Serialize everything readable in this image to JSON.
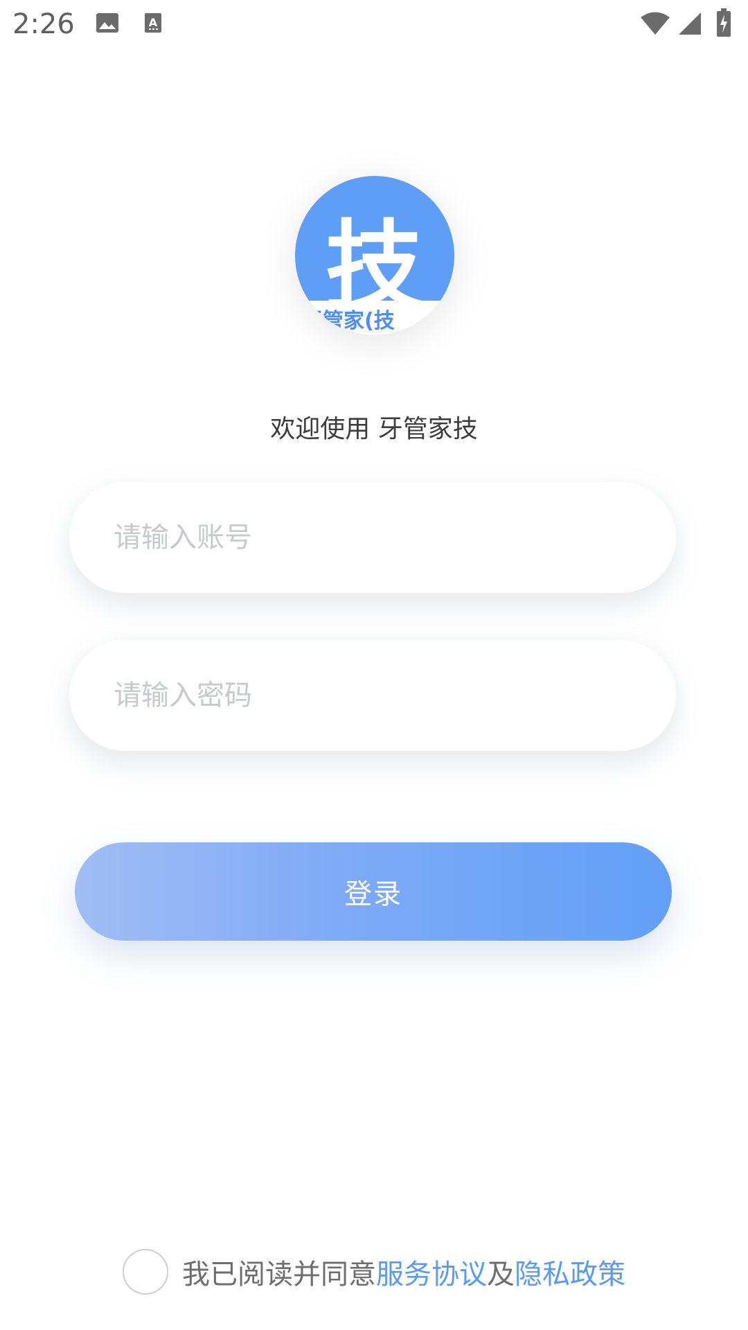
{
  "status_bar": {
    "time": "2:26",
    "icons": [
      "image-icon",
      "a-notification-icon",
      "wifi-icon",
      "signal-icon",
      "battery-charging-icon"
    ]
  },
  "logo": {
    "char": "技",
    "band_text": "牙管家(技"
  },
  "welcome": "欢迎使用 牙管家技",
  "form": {
    "account_placeholder": "请输入账号",
    "password_placeholder": "请输入密码",
    "login_label": "登录"
  },
  "agreement": {
    "prefix": "我已阅读并同意",
    "service_link": "服务协议",
    "conjunction": "及",
    "privacy_link": "隐私政策"
  },
  "colors": {
    "accent": "#5b9af3",
    "logo_bg": "#5f9ef7",
    "button_gradient_start": "#a1bdf4",
    "button_gradient_end": "#62a0f7"
  }
}
